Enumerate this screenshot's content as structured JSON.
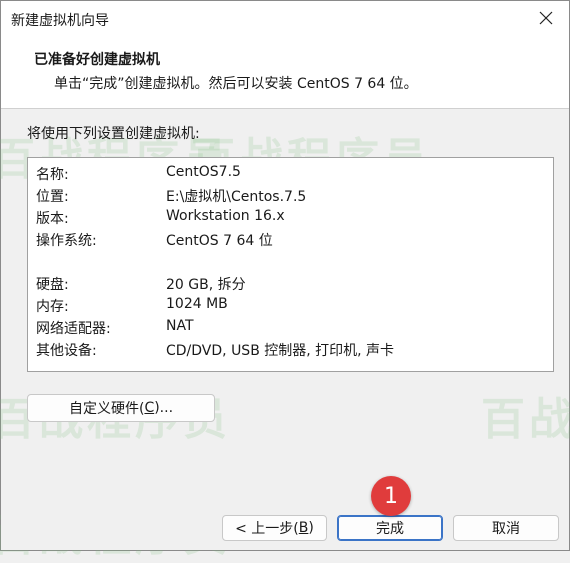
{
  "window": {
    "title": "新建虚拟机向导"
  },
  "header": {
    "title": "已准备好创建虚拟机",
    "subtitle": "单击“完成”创建虚拟机。然后可以安装 CentOS 7 64 位。"
  },
  "intro": "将使用下列设置创建虚拟机:",
  "summary": [
    {
      "label": "名称:",
      "value": "CentOS7.5"
    },
    {
      "label": "位置:",
      "value": "E:\\虚拟机\\Centos.7.5"
    },
    {
      "label": "版本:",
      "value": "Workstation 16.x"
    },
    {
      "label": "操作系统:",
      "value": "CentOS 7 64 位"
    },
    {
      "label": "硬盘:",
      "value": "20 GB, 拆分"
    },
    {
      "label": "内存:",
      "value": "1024 MB"
    },
    {
      "label": "网络适配器:",
      "value": "NAT"
    },
    {
      "label": "其他设备:",
      "value": "CD/DVD, USB 控制器, 打印机, 声卡"
    }
  ],
  "buttons": {
    "customize_prefix": "自定义硬件(",
    "customize_key": "C",
    "customize_suffix": ")...",
    "back_prefix": "< 上一步(",
    "back_key": "B",
    "back_suffix": ")",
    "finish": "完成",
    "cancel": "取消"
  },
  "badge": "1",
  "watermark": "百战程序员",
  "colors": {
    "accent": "#3b74c7",
    "badge": "#e03c3c"
  }
}
